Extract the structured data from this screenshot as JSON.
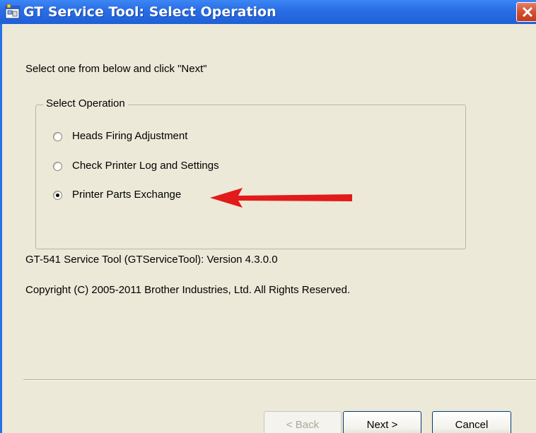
{
  "window": {
    "title": "GT Service Tool: Select Operation",
    "title_icon": "app-window-icon",
    "close_icon": "close-icon",
    "titlebar_color": "#2a6fe6",
    "close_color": "#d2502f",
    "background_color": "#ece9d8"
  },
  "dialog": {
    "instruction": "Select one from below and click \"Next\"",
    "group_label": "Select Operation",
    "options": [
      {
        "label": "Heads Firing Adjustment",
        "selected": false
      },
      {
        "label": "Check Printer Log and Settings",
        "selected": false
      },
      {
        "label": "Printer Parts Exchange",
        "selected": true
      }
    ],
    "annotation_arrow_color": "#e21a1a",
    "version": "GT-541 Service Tool (GTServiceTool): Version 4.3.0.0",
    "copyright": "Copyright (C) 2005-2011 Brother Industries, Ltd. All Rights Reserved."
  },
  "buttons": {
    "back": {
      "label": "< Back",
      "enabled": false
    },
    "next": {
      "label": "Next >",
      "enabled": true
    },
    "cancel": {
      "label": "Cancel",
      "enabled": true
    }
  }
}
